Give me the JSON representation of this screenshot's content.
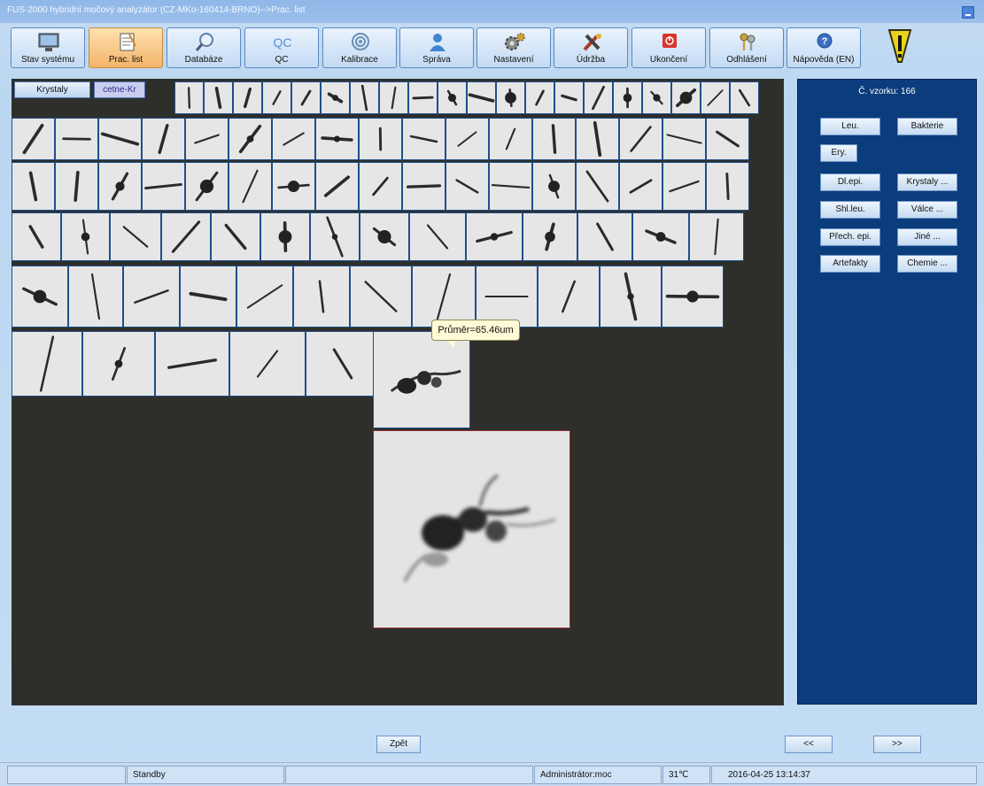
{
  "window": {
    "title": "FUS-2000 hybridní močový analyzátor (CZ-MKo-160414-BRNO)-->Prac. list"
  },
  "toolbar": {
    "items": [
      {
        "label": "Stav systému",
        "icon": "monitor-icon"
      },
      {
        "label": "Prac. list",
        "icon": "notepad-icon",
        "active": true
      },
      {
        "label": "Databáze",
        "icon": "magnifier-icon"
      },
      {
        "label": "QC",
        "icon": "qc-icon"
      },
      {
        "label": "Kalibrace",
        "icon": "target-icon"
      },
      {
        "label": "Správa",
        "icon": "user-icon"
      },
      {
        "label": "Nastavení",
        "icon": "gears-icon"
      },
      {
        "label": "Údržba",
        "icon": "tools-icon"
      },
      {
        "label": "Ukončení",
        "icon": "power-icon"
      },
      {
        "label": "Odhlášení",
        "icon": "keys-icon"
      },
      {
        "label": "Nápověda (EN)",
        "icon": "help-icon"
      }
    ],
    "qc_icon_text": "QC",
    "warning_icon": "warning-icon"
  },
  "tabs": [
    {
      "label": "Krystaly"
    },
    {
      "label": "cetne-Kr"
    }
  ],
  "tooltip": {
    "text": "Průměr=65.46um"
  },
  "side_panel": {
    "sample_label": "Č. vzorku: 166",
    "buttons": [
      {
        "label": "Leu."
      },
      {
        "label": "Bakterie"
      },
      {
        "label": "Ery."
      },
      {
        "label": "Dl.epi."
      },
      {
        "label": "Krystaly ..."
      },
      {
        "label": "Shl.leu."
      },
      {
        "label": "Válce ..."
      },
      {
        "label": "Přech. epi."
      },
      {
        "label": "Jiné ..."
      },
      {
        "label": "Artefakty"
      },
      {
        "label": "Chemie ..."
      }
    ]
  },
  "nav": {
    "back": "Zpět",
    "prev": "<<",
    "next": ">>"
  },
  "status_bar": {
    "state": "Standby",
    "user": "Administrátor:moc",
    "temperature": "31℃",
    "datetime": "2016-04-25 13:14:37"
  },
  "colors": {
    "canvas_bg": "#2e2f2b",
    "side_panel_bg": "#0b3c7c",
    "active_tab": "#f4b36a",
    "thumb_border": "#1f4f8a"
  }
}
